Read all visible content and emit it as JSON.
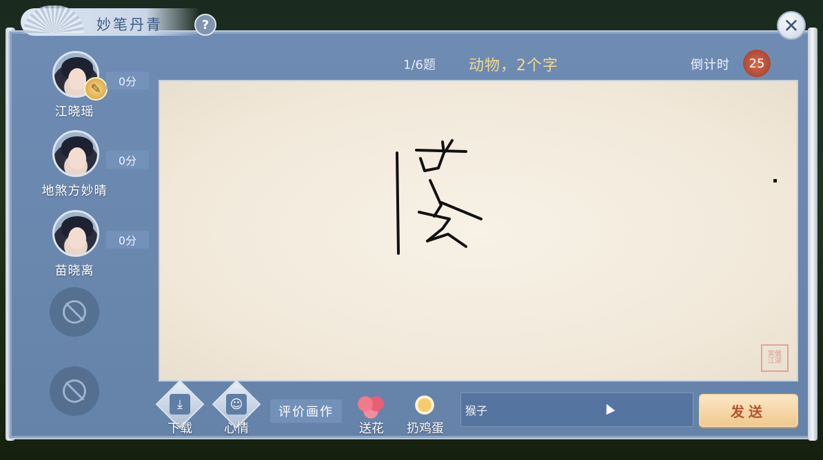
{
  "window": {
    "title": "妙笔丹青",
    "help_label": "?",
    "close_label": "✕"
  },
  "players": [
    {
      "name": "江晓瑶",
      "score": "0分",
      "is_drawing": true
    },
    {
      "name": "地煞方妙晴",
      "score": "0分",
      "is_drawing": false
    },
    {
      "name": "苗晓离",
      "score": "0分",
      "is_drawing": false
    }
  ],
  "empty_slots": 2,
  "round": {
    "progress": "1/6题",
    "hint": "动物，2个字",
    "countdown_label": "倒计时",
    "countdown_value": "25"
  },
  "canvas": {
    "seal_text": "笑傲江湖"
  },
  "toolbar": {
    "download_label": "下载",
    "mood_label": "心情",
    "rate_label": "评价画作",
    "flower_label": "送花",
    "egg_label": "扔鸡蛋"
  },
  "chat": {
    "input_value": "猴子",
    "send_label": "发送"
  },
  "colors": {
    "panel": "#6a88ae",
    "hint_gold": "#f3d98a",
    "send_text": "#b5532c"
  }
}
